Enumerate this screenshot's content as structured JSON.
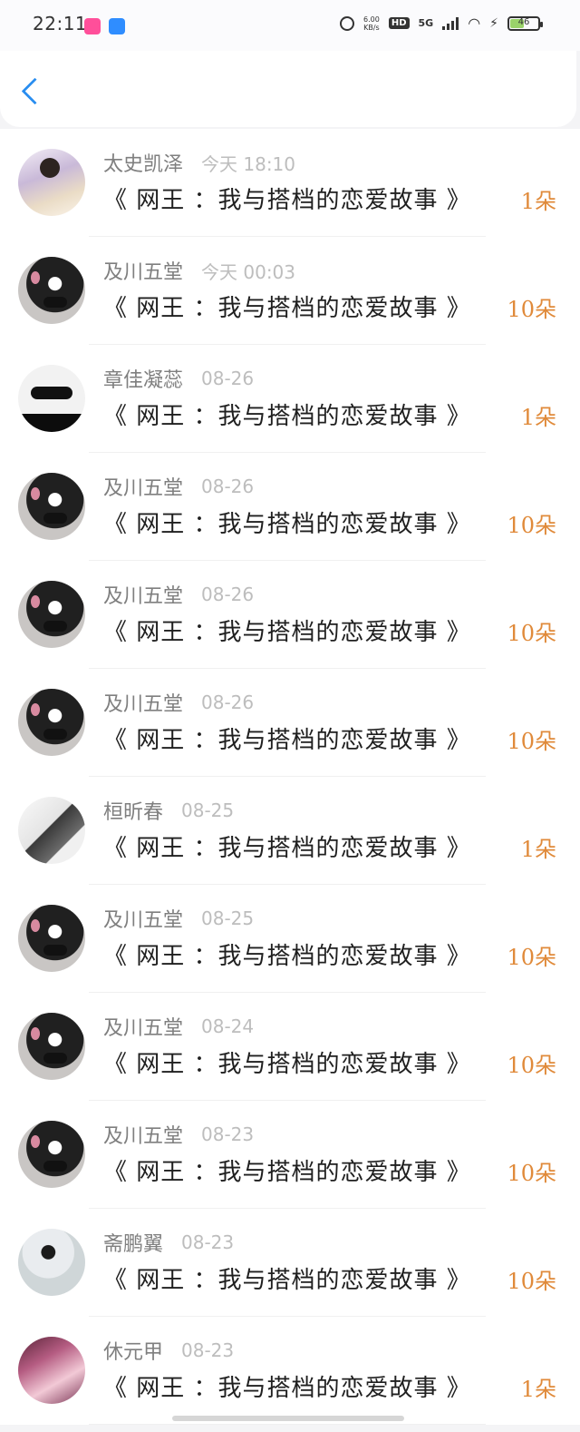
{
  "status_bar": {
    "time": "22:11",
    "net_speed_value": "6.00",
    "net_speed_unit": "KB/s",
    "hd": "HD",
    "network": "5G",
    "battery": "46"
  },
  "colors": {
    "accent": "#2a8ef0",
    "flower_count": "#e08a3a"
  },
  "items": [
    {
      "name": "太史凯泽",
      "date": "今天 18:10",
      "title": "《 网王 ：我与搭档的恋爱故事 》",
      "count": "1朵",
      "avatar": "girl-photo"
    },
    {
      "name": "及川五堂",
      "date": "今天 00:03",
      "title": "《 网王 ：我与搭档的恋爱故事 》",
      "count": "10朵",
      "avatar": "dark-hair-photo"
    },
    {
      "name": "章佳凝蕊",
      "date": "08-26",
      "title": "《 网王 ：我与搭档的恋爱故事 》",
      "count": "1朵",
      "avatar": "sunglasses-photo"
    },
    {
      "name": "及川五堂",
      "date": "08-26",
      "title": "《 网王 ：我与搭档的恋爱故事 》",
      "count": "10朵",
      "avatar": "dark-hair-photo"
    },
    {
      "name": "及川五堂",
      "date": "08-26",
      "title": "《 网王 ：我与搭档的恋爱故事 》",
      "count": "10朵",
      "avatar": "dark-hair-photo"
    },
    {
      "name": "及川五堂",
      "date": "08-26",
      "title": "《 网王 ：我与搭档的恋爱故事 》",
      "count": "10朵",
      "avatar": "dark-hair-photo"
    },
    {
      "name": "桓昕春",
      "date": "08-25",
      "title": "《 网王 ：我与搭档的恋爱故事 》",
      "count": "1朵",
      "avatar": "boy-photo"
    },
    {
      "name": "及川五堂",
      "date": "08-25",
      "title": "《 网王 ：我与搭档的恋爱故事 》",
      "count": "10朵",
      "avatar": "dark-hair-photo"
    },
    {
      "name": "及川五堂",
      "date": "08-24",
      "title": "《 网王 ：我与搭档的恋爱故事 》",
      "count": "10朵",
      "avatar": "dark-hair-photo"
    },
    {
      "name": "及川五堂",
      "date": "08-23",
      "title": "《 网王 ：我与搭档的恋爱故事 》",
      "count": "10朵",
      "avatar": "dark-hair-photo"
    },
    {
      "name": "斋鹏翼",
      "date": "08-23",
      "title": "《 网王 ：我与搭档的恋爱故事 》",
      "count": "10朵",
      "avatar": "white-dress-photo"
    },
    {
      "name": "休元甲",
      "date": "08-23",
      "title": "《 网王 ：我与搭档的恋爱故事 》",
      "count": "1朵",
      "avatar": "pink-photo"
    }
  ]
}
